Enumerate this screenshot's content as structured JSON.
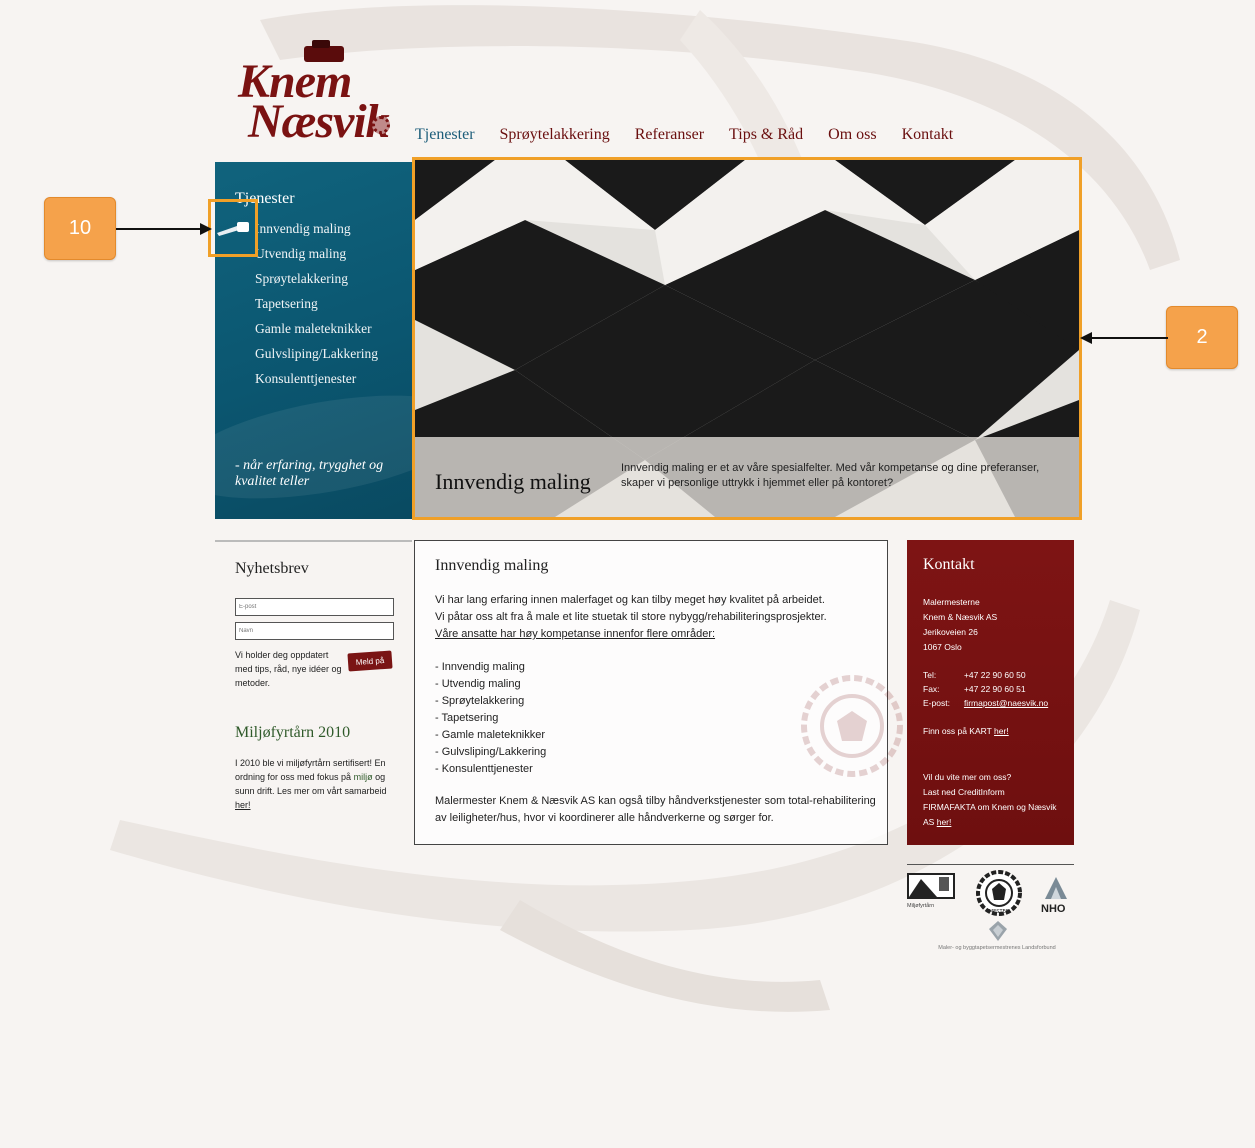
{
  "logo": {
    "line1": "Knem",
    "line2": "Næsvik"
  },
  "topnav": [
    "Tjenester",
    "Sprøytelakkering",
    "Referanser",
    "Tips & Råd",
    "Om oss",
    "Kontakt"
  ],
  "sidebar": {
    "title": "Tjenester",
    "items": [
      "Innvendig maling",
      "Utvendig maling",
      "Sprøytelakkering",
      "Tapetsering",
      "Gamle maleteknikker",
      "Gulvsliping/Lakkering",
      "Konsulenttjenester"
    ],
    "slogan": "- når erfaring, trygghet og kvalitet teller"
  },
  "hero": {
    "title": "Innvendig maling",
    "text": "Innvendig maling er et av våre spesialfelter. Med vår kompetanse og dine preferanser, skaper vi personlige uttrykk i hjemmet eller på kontoret?"
  },
  "callouts": {
    "left": "10",
    "right": "2"
  },
  "newsletter": {
    "title": "Nyhetsbrev",
    "email_placeholder": "E-post",
    "name_placeholder": "Navn",
    "pitch": "Vi holder deg oppdatert med tips, råd, nye idéer og metoder.",
    "signup": "Meld på",
    "env_title": "Miljøfyrtårn 2010",
    "env_text_1": "I 2010 ble vi miljøfyrtårn sertifisert! En ordning for oss med fokus på",
    "env_link": "miljø",
    "env_text_2": "og sunn drift. Les mer om vårt samarbeid",
    "env_here": "her!"
  },
  "main": {
    "title": "Innvendig maling",
    "intro_1": "Vi har lang erfaring innen malerfaget og kan tilby meget høy kvalitet på arbeidet.",
    "intro_2": "Vi påtar oss alt fra å male et lite stuetak til store nybygg/rehabiliteringsprosjekter.",
    "intro_3": "Våre ansatte har høy kompetanse innenfor flere områder:",
    "list": [
      "- Innvendig maling",
      "- Utvendig maling",
      "- Sprøytelakkering",
      "- Tapetsering",
      "- Gamle maleteknikker",
      "- Gulvsliping/Lakkering",
      "- Konsulenttjenester"
    ],
    "outro": "Malermester Knem & Næsvik AS kan også tilby håndverkstjenester som total-rehabilitering av leiligheter/hus, hvor vi koordinerer alle håndverkerne og sørger for."
  },
  "contact": {
    "title": "Kontakt",
    "company_1": "Malermesterne",
    "company_2": "Knem & Næsvik AS",
    "street": "Jerikoveien 26",
    "city": "1067 Oslo",
    "tel_label": "Tel:",
    "tel": "+47 22 90 60 50",
    "fax_label": "Fax:",
    "fax": "+47 22 90 60 51",
    "email_label": "E-post:",
    "email": "firmapost@naesvik.no",
    "map_text": "Finn oss på KART",
    "map_link": "her!",
    "more_1": "Vil du vite mer om oss?",
    "more_2": "Last ned CreditInform FIRMAFAKTA om Knem og Næsvik AS",
    "more_link": "her!"
  },
  "partners": {
    "miljo": "Miljøfyrtårn",
    "nho": "NHO",
    "mester": "MESTER",
    "forbund": "Maler- og byggtapetsermestrenes Landsforbund"
  },
  "colors": {
    "accent_orange": "#f0a028",
    "brand_red": "#7a1212",
    "sidebar_blue": "#0b5670"
  }
}
